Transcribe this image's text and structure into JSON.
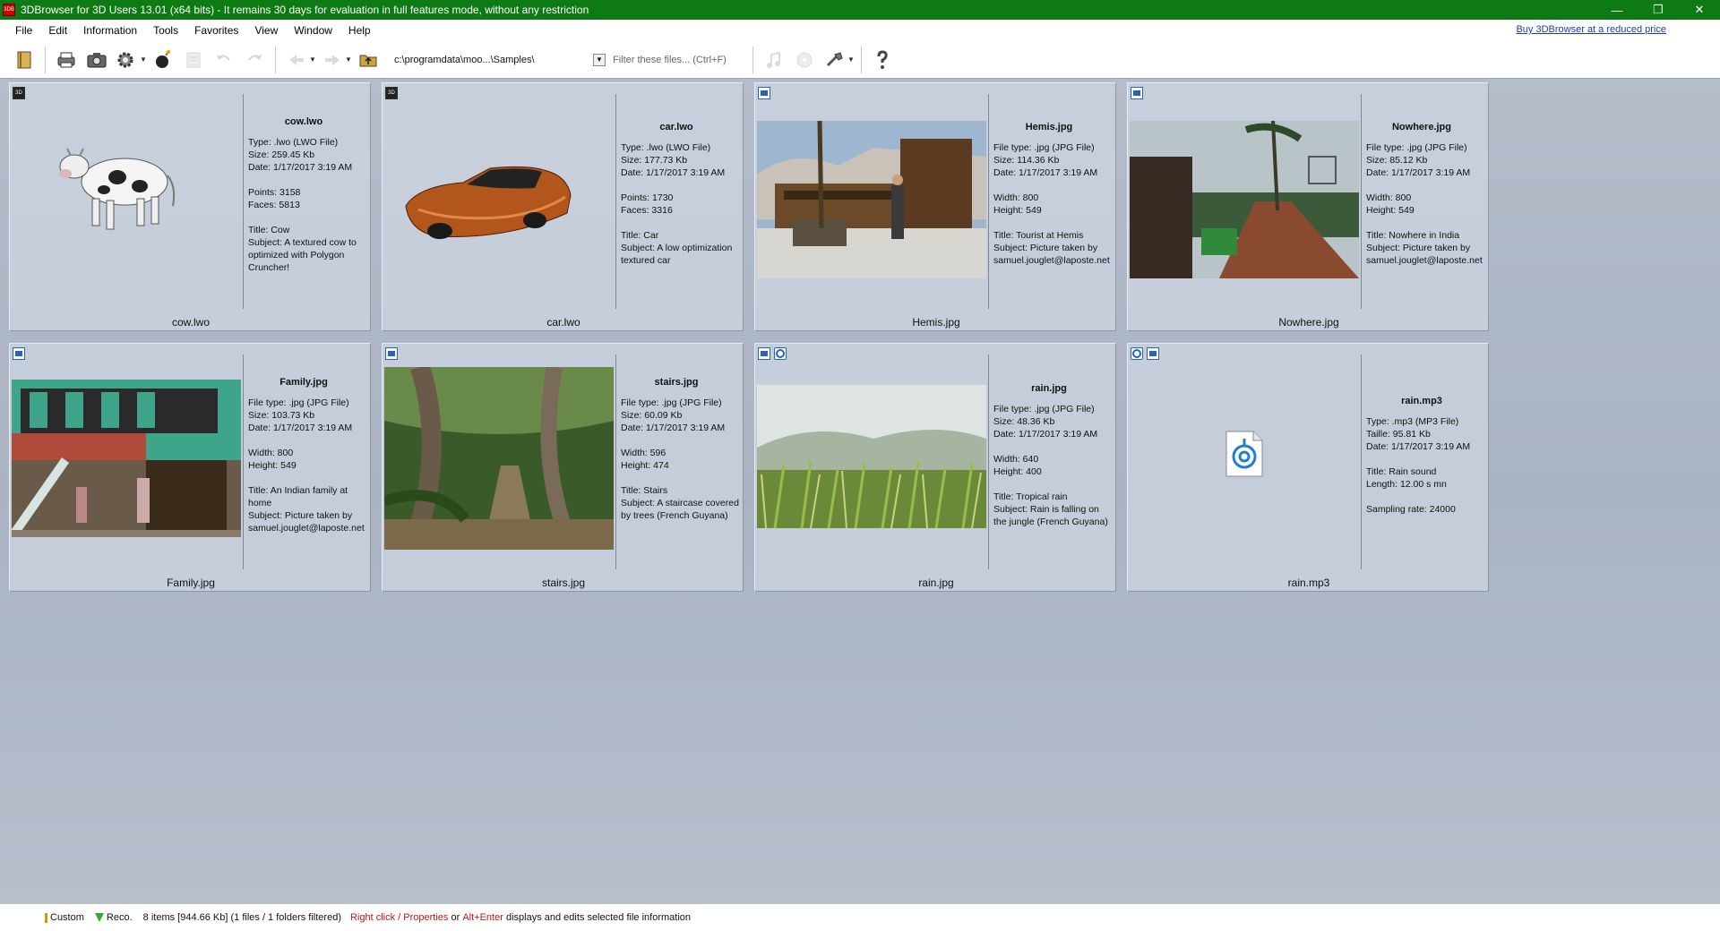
{
  "window": {
    "title": "3DBrowser for 3D Users 13.01 (x64 bits) - It remains 30 days for evaluation in full features mode, without any restriction",
    "app_icon_text": "3DB"
  },
  "menu": [
    "File",
    "Edit",
    "Information",
    "Tools",
    "Favorites",
    "View",
    "Window",
    "Help"
  ],
  "buy_link": "Buy 3DBrowser at a reduced price",
  "toolbar": {
    "path": "c:\\programdata\\moo...\\Samples\\",
    "filter_placeholder": "Filter these files... (Ctrl+F)"
  },
  "cards": [
    {
      "name": "cow.lwo",
      "badges": [
        "3D"
      ],
      "lines": [
        "Type: .lwo (LWO File)",
        "Size: 259.45 Kb",
        "Date: 1/17/2017 3:19 AM",
        "",
        "Points: 3158",
        "Faces: 5813",
        "",
        "Title: Cow",
        "Subject: A textured cow to optimized with Polygon Cruncher!"
      ],
      "caption": "cow.lwo"
    },
    {
      "name": "car.lwo",
      "badges": [
        "3D"
      ],
      "lines": [
        "Type: .lwo (LWO File)",
        "Size: 177.73 Kb",
        "Date: 1/17/2017 3:19 AM",
        "",
        "Points: 1730",
        "Faces: 3316",
        "",
        "Title: Car",
        "Subject: A low optimization textured car"
      ],
      "caption": "car.lwo"
    },
    {
      "name": "Hemis.jpg",
      "badges": [
        "img"
      ],
      "lines": [
        "File type: .jpg (JPG File)",
        "Size: 114.36 Kb",
        "Date: 1/17/2017 3:19 AM",
        "",
        "Width: 800",
        "Height: 549",
        "",
        "Title: Tourist at Hemis",
        "Subject: Picture taken by samuel.jouglet@laposte.net"
      ],
      "caption": "Hemis.jpg"
    },
    {
      "name": "Nowhere.jpg",
      "badges": [
        "img"
      ],
      "lines": [
        "File type: .jpg (JPG File)",
        "Size: 85.12 Kb",
        "Date: 1/17/2017 3:19 AM",
        "",
        "Width: 800",
        "Height: 549",
        "",
        "Title: Nowhere in India",
        "Subject: Picture taken by samuel.jouglet@laposte.net"
      ],
      "caption": "Nowhere.jpg"
    },
    {
      "name": "Family.jpg",
      "badges": [
        "img"
      ],
      "lines": [
        "File type: .jpg (JPG File)",
        "Size: 103.73 Kb",
        "Date: 1/17/2017 3:19 AM",
        "",
        "Width: 800",
        "Height: 549",
        "",
        "Title: An Indian family at home",
        "Subject: Picture taken by samuel.jouglet@laposte.net"
      ],
      "caption": "Family.jpg"
    },
    {
      "name": "stairs.jpg",
      "badges": [
        "img"
      ],
      "lines": [
        "File type: .jpg (JPG File)",
        "Size: 60.09 Kb",
        "Date: 1/17/2017 3:19 AM",
        "",
        "Width: 596",
        "Height: 474",
        "",
        "Title: Stairs",
        "Subject: A staircase covered by trees (French Guyana)"
      ],
      "caption": "stairs.jpg"
    },
    {
      "name": "rain.jpg",
      "badges": [
        "img",
        "audio"
      ],
      "lines": [
        "File type: .jpg (JPG File)",
        "Size: 48.36 Kb",
        "Date: 1/17/2017 3:19 AM",
        "",
        "Width: 640",
        "Height: 400",
        "",
        "Title: Tropical rain",
        "Subject: Rain is falling on the jungle (French Guyana)"
      ],
      "caption": "rain.jpg"
    },
    {
      "name": "rain.mp3",
      "badges": [
        "audio",
        "img"
      ],
      "lines": [
        "Type: .mp3 (MP3 File)",
        "Taille: 95.81 Kb",
        "Date: 1/17/2017 3:19 AM",
        "",
        "Title: Rain sound",
        "Length: 12.00 s mn",
        "",
        "Sampling rate: 24000"
      ],
      "caption": "rain.mp3"
    }
  ],
  "status": {
    "custom": "Custom",
    "reco": "Reco.",
    "summary": "8 items [944.66 Kb] (1 files / 1 folders filtered)",
    "right_click": "Right click",
    "slash": " / ",
    "properties": "Properties",
    "or": " or ",
    "alt_enter": "Alt+Enter",
    "tail": " displays and edits selected file information"
  }
}
